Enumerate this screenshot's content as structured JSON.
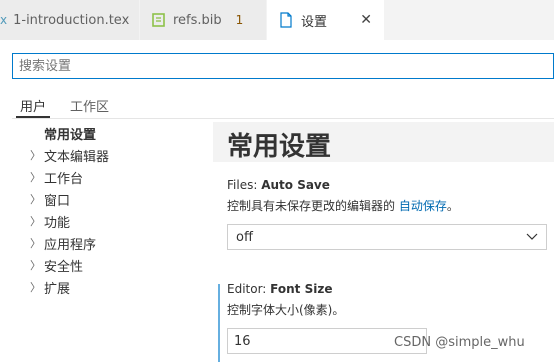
{
  "tabs": [
    {
      "prefix": "x",
      "label": "1-introduction.tex"
    },
    {
      "label": "refs.bib",
      "badge": "1"
    },
    {
      "label": "设置",
      "close": "✕",
      "active": true
    }
  ],
  "search": {
    "placeholder": "搜索设置"
  },
  "scope_tabs": [
    "用户",
    "工作区"
  ],
  "toc": {
    "selected": "常用设置",
    "items": [
      "文本编辑器",
      "工作台",
      "窗口",
      "功能",
      "应用程序",
      "安全性",
      "扩展"
    ]
  },
  "group_title": "常用设置",
  "settings": {
    "auto_save": {
      "category": "Files: ",
      "name": "Auto Save",
      "desc_prefix": "控制具有未保存更改的编辑器的 ",
      "desc_link": "自动保存",
      "desc_suffix": "。",
      "value": "off"
    },
    "font_size": {
      "category": "Editor: ",
      "name": "Font Size",
      "desc": "控制字体大小(像素)。",
      "value": "16"
    }
  },
  "watermark": "CSDN @simple_whu",
  "colors": {
    "accent": "#007acc",
    "link": "#006ab1",
    "modified_badge": "#895503",
    "modified_bar": "#66afe0"
  }
}
